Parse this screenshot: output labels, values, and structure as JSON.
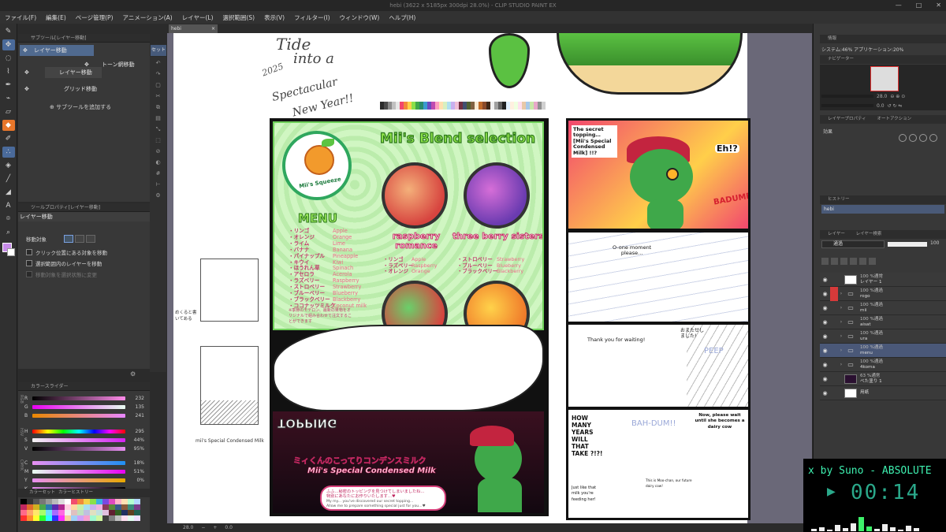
{
  "window": {
    "title": "hebi (3622 x 5185px 300dpi 28.0%)  - CLIP STUDIO PAINT EX",
    "controls": [
      "—",
      "□",
      "✕"
    ]
  },
  "menubar": [
    "ファイル(F)",
    "編集(E)",
    "ページ管理(P)",
    "アニメーション(A)",
    "レイヤー(L)",
    "選択範囲(S)",
    "表示(V)",
    "フィルター(I)",
    "ウィンドウ(W)",
    "ヘルプ(H)"
  ],
  "subtool": {
    "header": "サブツール[レイヤー移動]",
    "items": [
      "レイヤー移動",
      "レイヤー移動",
      "トーン網移動",
      "グリッド移動"
    ],
    "add_label": "サブツールを追加する",
    "set_tab": "セット1"
  },
  "toolprop": {
    "header": "ツールプロパティ[レイヤー移動]",
    "title": "レイヤー移動",
    "target_label": "移動対象",
    "options": [
      {
        "label": "クリック位置にある対象を移動",
        "enabled": true
      },
      {
        "label": "選択範囲内のレイヤーを移動",
        "enabled": true
      },
      {
        "label": "移動対象を選択状態に変更",
        "enabled": false
      }
    ]
  },
  "colorslider": {
    "tabs": [
      "カラースライダー"
    ],
    "groups": [
      "RGB",
      "HSV",
      "CMYK"
    ],
    "rows": [
      {
        "label": "R",
        "value": "232",
        "gradient": "linear-gradient(90deg,#000,#ff8bea)"
      },
      {
        "label": "G",
        "value": "135",
        "gradient": "linear-gradient(90deg,#e800f1,#e8fff1)"
      },
      {
        "label": "B",
        "value": "241",
        "gradient": "linear-gradient(90deg,#e88700,#e887ff)"
      },
      {
        "label": "H",
        "value": "295",
        "gradient": "linear-gradient(90deg,#f00,#ff0,#0f0,#0ff,#00f,#f0f,#f00)"
      },
      {
        "label": "S",
        "value": "44%",
        "gradient": "linear-gradient(90deg,#f3f3f3,#d321f1)"
      },
      {
        "label": "V",
        "value": "95%",
        "gradient": "linear-gradient(90deg,#000,#e88ff1)"
      },
      {
        "label": "C",
        "value": "18%",
        "gradient": "linear-gradient(90deg,#e88ff1,#1f8ff1)"
      },
      {
        "label": "M",
        "value": "51%",
        "gradient": "linear-gradient(90deg,#e8fff1,#e800f1)"
      },
      {
        "label": "Y",
        "value": "0%",
        "gradient": "linear-gradient(90deg,#e88ff1,#e8a800)"
      },
      {
        "label": "K",
        "value": "",
        "gradient": "linear-gradient(90deg,#e88ff1,#000)"
      }
    ]
  },
  "colorset": {
    "tabs": [
      "カラーセット",
      "カラーヒストリー"
    ],
    "colors": [
      "#000000",
      "#333333",
      "#555555",
      "#777777",
      "#999999",
      "#bbbbbb",
      "#dddddd",
      "#ffffff",
      "#f24d6e",
      "#f28a3a",
      "#f2d24a",
      "#8ae04a",
      "#3ab0e0",
      "#7a4ae0",
      "#e04ac0",
      "#ffb3c8",
      "#ffe0b3",
      "#b3ffd0",
      "#b3d8ff",
      "#c0265f",
      "#e06a2a",
      "#d0b020",
      "#4aa84a",
      "#2a7ab0",
      "#5a2ab0",
      "#b02a90",
      "#ffd0e0",
      "#ffd8a0",
      "#c8f0a8",
      "#a8e0f0",
      "#c8b0f0",
      "#f0b0e0",
      "#8a3a5a",
      "#5a8a3a",
      "#3a5a8a",
      "#8a5a3a",
      "#3a8a7a",
      "#7a3a8a",
      "#ff6a8a",
      "#ffa86a",
      "#ffe86a",
      "#a8ff6a",
      "#6ae0ff",
      "#a86aff",
      "#ff6ae0",
      "#f0f0f0",
      "#e0c0c0",
      "#c0e0c0",
      "#c0c0e0",
      "#e0e0c0",
      "#c0e0e0",
      "#e0c0e0",
      "#602030",
      "#306020",
      "#203060",
      "#604020",
      "#206050",
      "#ff3030",
      "#ff9030",
      "#ffff30",
      "#30ff30",
      "#30ffff",
      "#3030ff",
      "#ff30ff",
      "#f8d0a0",
      "#a0d0f8",
      "#d0a0f8",
      "#f8a0d0",
      "#a0f8d0",
      "#d0f8a0",
      "#404040",
      "#808080",
      "#c0c0c0",
      "#ffe0f0",
      "#e0fff0",
      "#f0e0ff"
    ]
  },
  "tool_icons": {
    "column1": [
      "pen-tip-icon",
      "move-icon",
      "lasso-icon",
      "eyedropper-icon",
      "pen-icon",
      "brush-icon",
      "eraser-icon",
      "paint-icon",
      "pencil-icon",
      "airbrush-icon",
      "fill-icon",
      "line-icon",
      "shape-icon",
      "text-icon",
      "bubble-icon",
      "zoom-icon"
    ],
    "column2": [
      "undo-icon",
      "redo-icon",
      "clear-icon",
      "cut-icon",
      "copy-icon",
      "paste-icon",
      "transform-icon",
      "select-icon",
      "deselect-icon",
      "invert-icon",
      "grid-icon",
      "ruler-icon",
      "settings-icon"
    ]
  },
  "document_tab": {
    "label": "hebi",
    "close": "×"
  },
  "canvas_status": {
    "zoom": "28.0",
    "angle": "0.0"
  },
  "sketches": {
    "line1": "Tide",
    "line2": "into a",
    "line3": "Spectacular",
    "line4": "New Year!!",
    "year": "2025",
    "caption": "mii's Special Condensed Milk",
    "note": "めくると書いてある"
  },
  "palette_strip": [
    "#2a2a2a",
    "#4a4a4a",
    "#8a8a8a",
    "#c0c0c0",
    "#e8e8e8",
    "#f2476e",
    "#f28a3a",
    "#ffd24a",
    "#8ae04a",
    "#3fa84a",
    "#2a8a6a",
    "#3a9ad0",
    "#6a4ac0",
    "#c04ab0",
    "#ff9ec0",
    "#ffe0b0",
    "#d8f0c0",
    "#b0e0f0",
    "#c8b0f0",
    "#f0c0d8",
    "#703040",
    "#405070",
    "#506030",
    "#806040",
    "#f8e8d0",
    "#c06a2a",
    "#8a4a2a",
    "#402818",
    "#f0f0f0",
    "#a0a0a0",
    "#606060",
    "#202020",
    "#e0f0ff",
    "#fff0e0",
    "#f0ffe0",
    "#ffe0f0",
    "#e8c8a8",
    "#a8c8e8",
    "#c8e8a8",
    "#e8a8c8",
    "#909090",
    "#d0d0d0"
  ],
  "menu_page": {
    "title": "Mii's Blend selection",
    "logo_text": "Mii's Squeeze",
    "heading": "MENU",
    "menu_jp": [
      "・リンゴ",
      "・オレンジ",
      "・ライム",
      "・バナナ",
      "・パイナップル",
      "・キウイ",
      "・ほうれん草",
      "・アセロラ",
      "・ラズベリー",
      "・ストロベリー",
      "・ブルーベリー",
      "・ブラックベリー",
      "・ココナッツミルク"
    ],
    "menu_en": [
      "Apple",
      "Orange",
      "Lime",
      "Banana",
      "Pineapple",
      "Kiwi",
      "Spinach",
      "Acerola",
      "Raspberry",
      "Strawberry",
      "Blueberry",
      "Blackberry",
      "Coconut milk"
    ],
    "footnote": "※季節のモテロン、最新の果物をオリジナルで組み合わせて注文することができます",
    "drink1_name": "raspberry romance",
    "drink1_jp": [
      "・リンゴ",
      "・ラズベリー",
      "・オレンジ"
    ],
    "drink1_en": [
      "Apple",
      "Raspberry",
      "Orange"
    ],
    "drink2_name": "three berry sisters",
    "drink2_jp": [
      "・ストロベリー",
      "・ブルーベリー",
      "・ブラックベリー"
    ],
    "drink2_en": [
      "Strawberry",
      "Blueberry",
      "Blackberry"
    ],
    "topping": "TOPPING",
    "condensed_jp": "ミィくんのこってりコンデンスミルク",
    "condensed_en": "Mii's Special Condensed Milk",
    "bubble_jp": "ふふ…秘密のトッピングを見つけてしまいましたね…\n特別にあなたにお作りいたします…♥",
    "bubble_en": "My my... you've discovered our secret topping...\nAllow me to prepare something special just for you...♥"
  },
  "comic": {
    "p1_bubble": "The secret topping… [Mii's Special Condensed Milk] !!?",
    "p1_eh": "Eh!?",
    "p1_dump": "BADUMP!",
    "p2_text": "O-one moment\nplease...",
    "p3_text": "Thank you for waiting!",
    "p3_jp": "おまたせしました!",
    "p3_peep": "PEEP",
    "p4_how": "HOW MANY YEARS WILL THAT TAKE ?!?!",
    "p4_bah": "BAH-DUM!!",
    "p4_now": "Now, please wait until she becomes a dairy cow",
    "p4_small": "This is Moo-chan, our future dairy cow!",
    "p4_just": "Just like that milk you're feeding her!"
  },
  "right": {
    "info_header": "情報",
    "info_text": "システム:46% アプリケーション:20%",
    "navigator_header": "ナビゲーター",
    "nav_zoom": "28.0",
    "nav_angle": "0.0",
    "layerprop_header": "レイヤープロパティ",
    "autoaction_header": "オートアクション",
    "effect_label": "効果",
    "history_header": "ヒストリー",
    "history_item": "hebi",
    "layer_header": "レイヤー",
    "layersearch_header": "レイヤー検索",
    "layer_mode": "通過",
    "layer_opacity": "100",
    "layers": [
      {
        "mode": "100 %通常",
        "name": "レイヤー 1",
        "type": "raster",
        "lock": false,
        "selected": false
      },
      {
        "mode": "100 %通過",
        "name": "rogo",
        "type": "folder",
        "lock": true,
        "selected": false
      },
      {
        "mode": "100 %通過",
        "name": "mii",
        "type": "folder",
        "lock": false,
        "selected": false
      },
      {
        "mode": "100 %通過",
        "name": "aisat",
        "type": "folder",
        "lock": false,
        "selected": false
      },
      {
        "mode": "100 %通過",
        "name": "ura",
        "type": "folder",
        "lock": false,
        "selected": false
      },
      {
        "mode": "100 %通過",
        "name": "menu",
        "type": "folder",
        "lock": false,
        "selected": true
      },
      {
        "mode": "100 %通過",
        "name": "4koma",
        "type": "folder",
        "lock": false,
        "selected": false
      },
      {
        "mode": "63 %通常",
        "name": "べた塗り 1",
        "type": "dark",
        "lock": false,
        "selected": false
      },
      {
        "mode": "",
        "name": "用紙",
        "type": "raster",
        "lock": false,
        "selected": false
      }
    ]
  },
  "music": {
    "title": "x by Suno - ABSOLUTE",
    "time": "00:14",
    "bars": [
      3,
      5,
      2,
      8,
      4,
      10,
      18,
      6,
      3,
      9,
      5,
      2,
      7,
      4
    ],
    "green_bars": [
      6,
      7
    ]
  }
}
